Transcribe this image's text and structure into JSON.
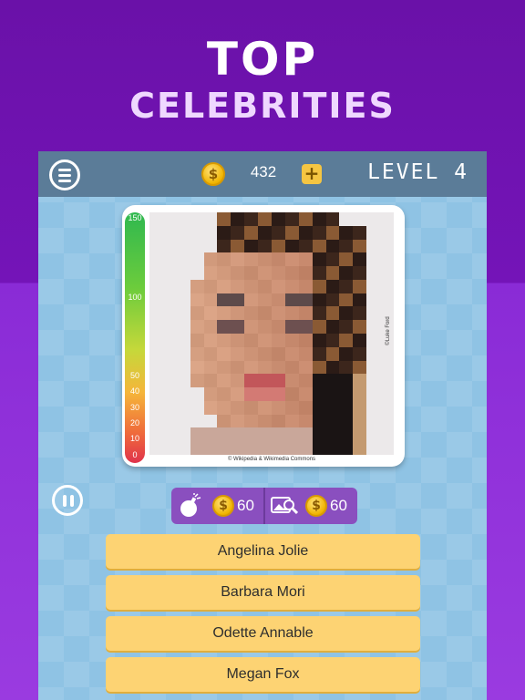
{
  "hero": {
    "line1": "TOP",
    "line2": "CELEBRITIES"
  },
  "topbar": {
    "coins": "432",
    "coin_symbol": "$",
    "plus_label": "+",
    "level": "LEVEL 4"
  },
  "meter": {
    "labels": [
      "150",
      "100",
      "50",
      "40",
      "30",
      "20",
      "10",
      "0"
    ]
  },
  "photo": {
    "credit_bottom": "© Wikipedia & Wikimedia Commons",
    "credit_side": "©Luke Ford"
  },
  "powerups": [
    {
      "icon": "bomb-icon",
      "price": "60",
      "coin_symbol": "$"
    },
    {
      "icon": "reveal-image-icon",
      "price": "60",
      "coin_symbol": "$"
    }
  ],
  "answers": [
    "Angelina Jolie",
    "Barbara Mori",
    "Odette Annable",
    "Megan Fox"
  ],
  "colors": {
    "background_top": "#7414b8",
    "background_bottom": "#9a3be0",
    "topbar": "#5b7c98",
    "screen": "#8fc3e4",
    "answer_button": "#fdd373",
    "powerup_bar": "#8a4fbf",
    "coin": "#f0b400"
  }
}
